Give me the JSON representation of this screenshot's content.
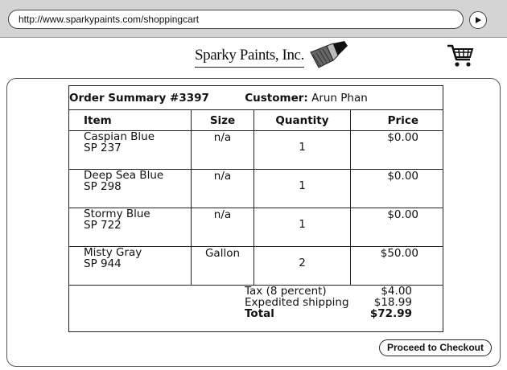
{
  "browser": {
    "url": "http://www.sparkypaints.com/shoppingcart",
    "go_icon": "play-arrow-icon"
  },
  "header": {
    "brand": "Sparky Paints, Inc.",
    "brush_icon": "paintbrush-icon",
    "cart_icon": "shopping-cart-icon"
  },
  "order": {
    "summary_label": "Order Summary #3397",
    "customer_label": "Customer:",
    "customer_name": "Arun Phan",
    "columns": {
      "item": "Item",
      "size": "Size",
      "quantity": "Quantity",
      "price": "Price"
    },
    "items": [
      {
        "name": "Caspian Blue",
        "code": "SP 237",
        "size": "n/a",
        "quantity": "1",
        "price": "$0.00"
      },
      {
        "name": "Deep Sea Blue",
        "code": "SP 298",
        "size": "n/a",
        "quantity": "1",
        "price": "$0.00"
      },
      {
        "name": "Stormy Blue",
        "code": "SP 722",
        "size": "n/a",
        "quantity": "1",
        "price": "$0.00"
      },
      {
        "name": "Misty Gray",
        "code": "SP 944",
        "size": "Gallon",
        "quantity": "2",
        "price": "$50.00"
      }
    ],
    "totals": {
      "tax_label": "Tax (8 percent)",
      "tax_value": "$4.00",
      "shipping_label": "Expedited shipping",
      "shipping_value": "$18.99",
      "total_label": "Total",
      "total_value": "$72.99"
    }
  },
  "actions": {
    "checkout_label": "Proceed to Checkout"
  }
}
